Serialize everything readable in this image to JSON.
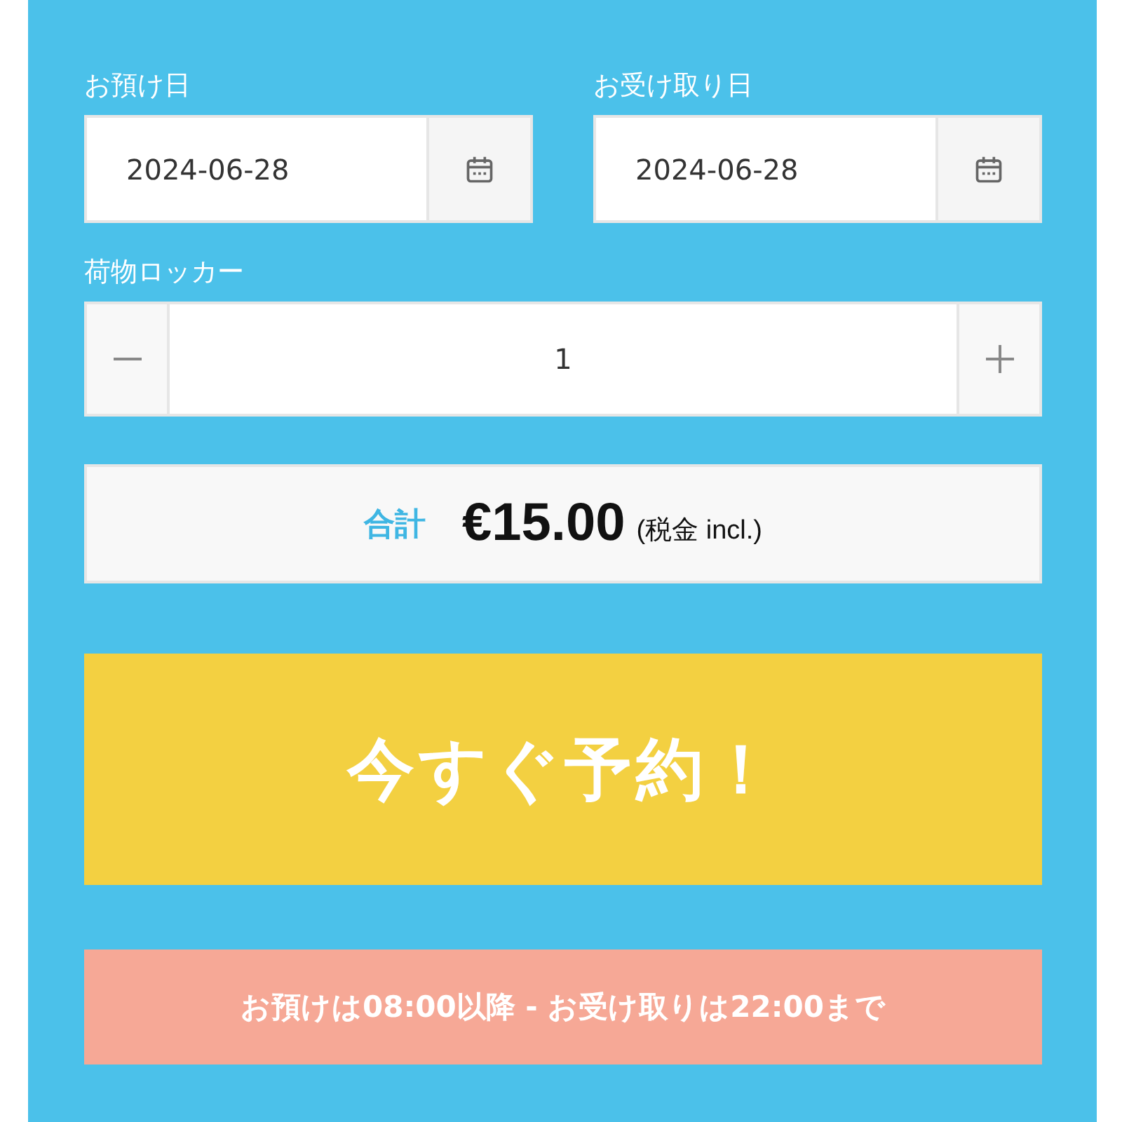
{
  "date_fields": [
    {
      "label": "お預け日",
      "value": "2024-06-28"
    },
    {
      "label": "お受け取り日",
      "value": "2024-06-28"
    }
  ],
  "locker": {
    "label": "荷物ロッカー",
    "value": "1"
  },
  "total": {
    "label": "合計",
    "amount": "€15.00",
    "note": "(税金 incl.)"
  },
  "book_button": "今すぐ予約！",
  "hours_note": "お預けは08:00以降 - お受け取りは22:00まで"
}
